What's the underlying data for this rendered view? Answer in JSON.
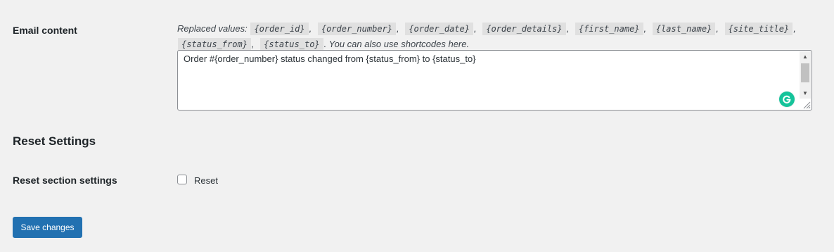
{
  "email_content": {
    "label": "Email content",
    "replaced_prefix": "Replaced values:",
    "placeholders": [
      "{order_id}",
      "{order_number}",
      "{order_date}",
      "{order_details}",
      "{first_name}",
      "{last_name}",
      "{site_title}",
      "{status_from}",
      "{status_to}"
    ],
    "separator": ",",
    "suffix": ". You can also use shortcodes here.",
    "textarea_value": "Order #{order_number} status changed from {status_from} to {status_to}"
  },
  "reset": {
    "section_title": "Reset Settings",
    "row_label": "Reset section settings",
    "checkbox_label": "Reset",
    "checked": false
  },
  "actions": {
    "save_label": "Save changes"
  },
  "colors": {
    "primary": "#2271b1",
    "background": "#f1f1f1",
    "grammarly": "#15c39a"
  },
  "icons": {
    "grammarly": "grammarly-icon",
    "scroll_up": "scroll-up-arrow-icon",
    "scroll_down": "scroll-down-arrow-icon",
    "resize": "resize-grip-icon"
  }
}
